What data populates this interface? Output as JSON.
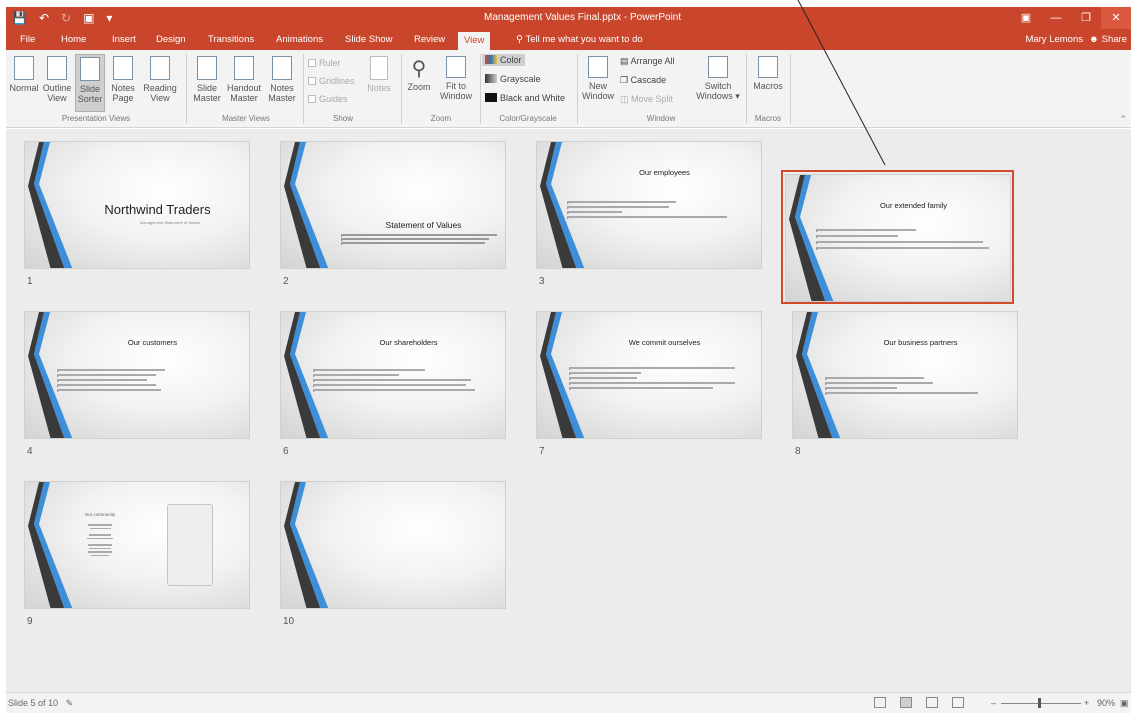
{
  "window": {
    "title": "Management Values Final.pptx - PowerPoint",
    "user": "Mary Lemons",
    "share_label": "Share"
  },
  "tabs": [
    {
      "label": "File"
    },
    {
      "label": "Home"
    },
    {
      "label": "Insert"
    },
    {
      "label": "Design"
    },
    {
      "label": "Transitions"
    },
    {
      "label": "Animations"
    },
    {
      "label": "Slide Show"
    },
    {
      "label": "Review"
    },
    {
      "label": "View"
    }
  ],
  "active_tab": "View",
  "tell_me": "Tell me what you want to do",
  "ribbon": {
    "presentation_views": {
      "label": "Presentation Views",
      "buttons": [
        {
          "line1": "Normal",
          "line2": ""
        },
        {
          "line1": "Outline",
          "line2": "View"
        },
        {
          "line1": "Slide",
          "line2": "Sorter"
        },
        {
          "line1": "Notes",
          "line2": "Page"
        },
        {
          "line1": "Reading",
          "line2": "View"
        }
      ]
    },
    "master_views": {
      "label": "Master Views",
      "buttons": [
        {
          "line1": "Slide",
          "line2": "Master"
        },
        {
          "line1": "Handout",
          "line2": "Master"
        },
        {
          "line1": "Notes",
          "line2": "Master"
        }
      ]
    },
    "show": {
      "label": "Show",
      "checks": [
        "Ruler",
        "Gridlines",
        "Guides"
      ],
      "notes_label": "Notes"
    },
    "zoom": {
      "label": "Zoom",
      "zoom_label": "Zoom",
      "fit_line1": "Fit to",
      "fit_line2": "Window"
    },
    "color": {
      "label": "Color/Grayscale",
      "items": [
        "Color",
        "Grayscale",
        "Black and White"
      ]
    },
    "window": {
      "label": "Window",
      "new_line1": "New",
      "new_line2": "Window",
      "items": [
        "Arrange All",
        "Cascade",
        "Move Split"
      ],
      "switch_line1": "Switch",
      "switch_line2": "Windows"
    },
    "macros": {
      "label": "Macros",
      "button": "Macros"
    }
  },
  "slides": [
    {
      "number": "1",
      "title": "Northwind Traders",
      "subtitle": "Management Statement of Values",
      "bullets": []
    },
    {
      "number": "2",
      "title": "Statement of Values",
      "subtitle": "",
      "bullets": []
    },
    {
      "number": "3",
      "title": "Our employees",
      "subtitle": "",
      "bullets": [
        "",
        "",
        "",
        ""
      ]
    },
    {
      "number": "5",
      "title": "Our extended family",
      "subtitle": "",
      "bullets": [
        "",
        "",
        "",
        ""
      ]
    },
    {
      "number": "4",
      "title": "Our customers",
      "subtitle": "",
      "bullets": [
        "",
        "",
        "",
        "",
        ""
      ]
    },
    {
      "number": "6",
      "title": "Our shareholders",
      "subtitle": "",
      "bullets": [
        "",
        "",
        "",
        "",
        ""
      ]
    },
    {
      "number": "7",
      "title": "We commit ourselves",
      "subtitle": "",
      "bullets": [
        "",
        "",
        "",
        "",
        ""
      ]
    },
    {
      "number": "8",
      "title": "Our business partners",
      "subtitle": "",
      "bullets": [
        "",
        "",
        "",
        ""
      ]
    },
    {
      "number": "9",
      "title": "Our community",
      "subtitle": "",
      "bullets": []
    },
    {
      "number": "10",
      "title": "",
      "subtitle": "",
      "bullets": []
    }
  ],
  "slide_labels": [
    "1",
    "2",
    "3",
    "",
    "4",
    "6",
    "7",
    "8",
    "9",
    "10"
  ],
  "status": {
    "slide_info": "Slide 5 of 10",
    "zoom_pct": "90%"
  }
}
